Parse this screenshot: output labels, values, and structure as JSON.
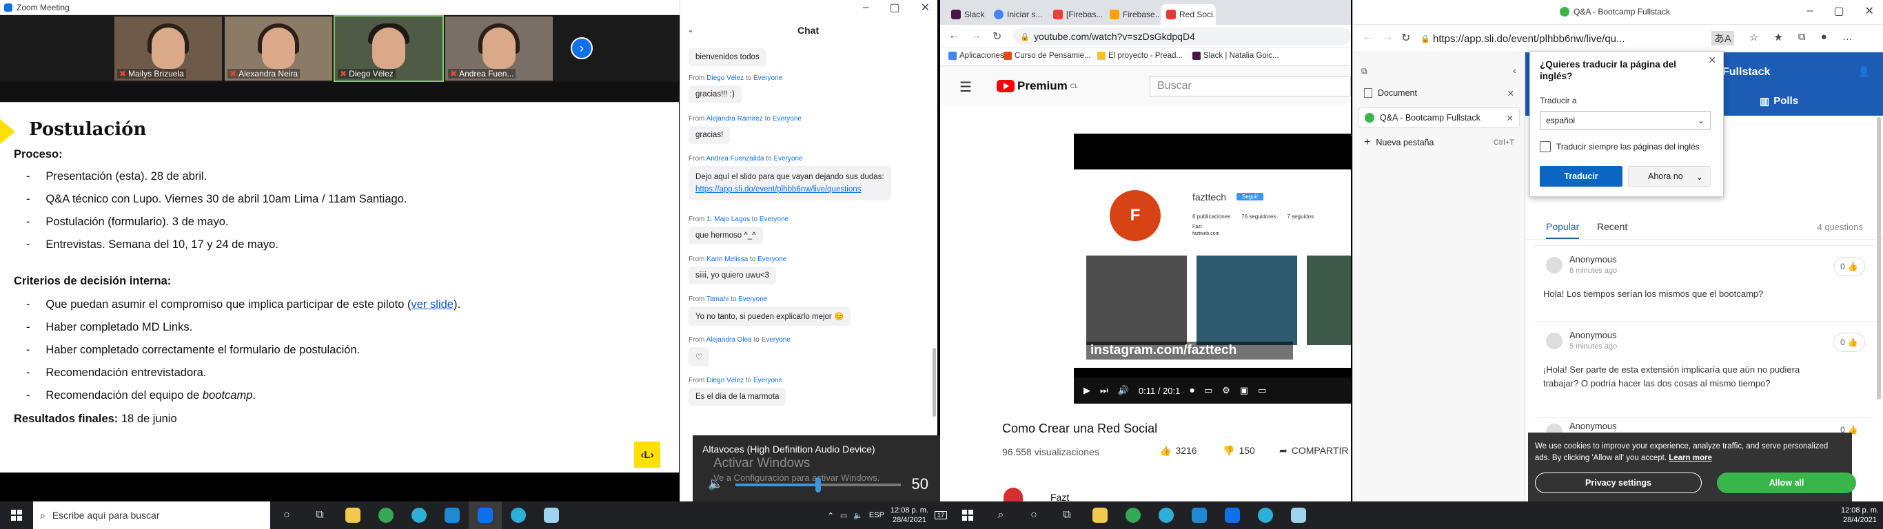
{
  "zoom": {
    "window_title": "Zoom Meeting",
    "participants": [
      "Mailys Brizuela",
      "Alexandra Neira",
      "Diego Vélez",
      "Andrea Fuen..."
    ],
    "slide": {
      "title": "Postulación",
      "proceso_label": "Proceso:",
      "proceso_items": [
        "Presentación (esta). 28 de abril.",
        "Q&A técnico con Lupo. Viernes 30 de abril 10am Lima / 11am Santiago.",
        "Postulación (formulario). 3 de mayo.",
        "Entrevistas. Semana del 10, 17 y 24 de mayo."
      ],
      "criterios_label": "Criterios de decisión interna:",
      "criterios_item_1_pre": "Que puedan asumir el compromiso que implica participar de este piloto (",
      "criterios_item_1_link": "ver slide",
      "criterios_item_1_post": ").",
      "criterios_items": [
        "Haber completado MD Links.",
        "Haber completado correctamente el formulario de postulación.",
        "Recomendación entrevistadora."
      ],
      "criterios_last_pre": "Recomendación del equipo de ",
      "criterios_last_em": "bootcamp",
      "criterios_last_post": ".",
      "resultados_label": "Resultados finales:",
      "resultados_value": " 18 de junio",
      "logo": "‹L›"
    },
    "chat": {
      "title": "Chat",
      "first_message": "bienvenidos todos",
      "messages": [
        {
          "from": "Diego Vélez",
          "to": "Everyone",
          "text": "gracias!!! :)"
        },
        {
          "from": "Alejandra Ramirez",
          "to": "Everyone",
          "text": "gracias!"
        },
        {
          "from": "Andrea Fuenzalida",
          "to": "Everyone",
          "text": "Dejo aquí el slido para que vayan dejando sus dudas:",
          "link": "https://app.sli.do/event/plhbb6nw/live/questions"
        },
        {
          "from": "1. Majo Lagos",
          "to": "Everyone",
          "text": "que hermoso ^_^"
        },
        {
          "from": "Karin Melissa",
          "to": "Everyone",
          "text": "siiii, yo quiero uwu<3"
        },
        {
          "from": "Tamahi",
          "to": "Everyone",
          "text": "Yo no tanto, si pueden explicarlo mejor 😊"
        },
        {
          "from": "Alejandra Olea",
          "to": "Everyone",
          "text": "♡"
        },
        {
          "from": "Diego Vélez",
          "to": "Everyone",
          "text": "Es el día de la marmota"
        }
      ],
      "from_word": "From",
      "to_word": "to"
    },
    "audio_popup": {
      "device": "Altavoces (High Definition Audio Device)",
      "volume": "50",
      "watermark_1": "Activar Windows",
      "watermark_2": "Ve a Configuración para activar Windows."
    }
  },
  "chrome": {
    "tabs": [
      "Slack | N...",
      "Iniciar s...",
      "[Firebas...",
      "Firebase...",
      "Red Soci..."
    ],
    "url": "youtube.com/watch?v=szDsGkdpqD4",
    "bookmarks": [
      "Aplicaciones",
      "Curso de Pensamie...",
      "El proyecto - Pread...",
      "Slack | Natalia Goic..."
    ],
    "youtube": {
      "logo": "Premium",
      "logo_sup": "CL",
      "search_placeholder": "Buscar",
      "video_title": "Como Crear una Red Social",
      "views": "96.558 visualizaciones",
      "likes": "3216",
      "dislikes": "150",
      "share": "COMPARTIR",
      "overlay_text": "instagram.com/fazttech",
      "profile_name": "fazttech",
      "follow_label": "Seguir",
      "stats": [
        "6 publicaciones",
        "76 seguidores",
        "7 seguidos"
      ],
      "bio_1": "Fazt",
      "bio_2": "faztweb.com",
      "time": "0:11 / 20:1",
      "channel": "Fazt"
    }
  },
  "edge": {
    "tab_title": "Q&A - Bootcamp Fullstack",
    "url": "https://app.sli.do/event/plhbb6nw/live/qu...",
    "vertical_tabs": [
      {
        "title": "Document"
      },
      {
        "title": "Q&A - Bootcamp Fullstack"
      }
    ],
    "new_tab": "Nueva pestaña",
    "new_tab_shortcut": "Ctrl+T",
    "translate": {
      "question": "¿Quieres traducir la página del inglés?",
      "to_label": "Traducir a",
      "language": "español",
      "always_label": "Traducir siempre las páginas del inglés",
      "translate_btn": "Traducir",
      "not_now_btn": "Ahora no"
    },
    "slido": {
      "header_title": "Fullstack",
      "polls_tab": "Polls",
      "popular_tab": "Popular",
      "recent_tab": "Recent",
      "count": "4 questions",
      "questions": [
        {
          "author": "Anonymous",
          "time": "8 minutes ago",
          "likes": "0",
          "text": "Hola! Los tiempos serían los mismos que el bootcamp?"
        },
        {
          "author": "Anonymous",
          "time": "5 minutes ago",
          "likes": "0",
          "text": "¡Hola! Ser parte de esta extensión implicaría que aún no pudiera",
          "text2": "trabajar? O podría hacer las dos cosas al mismo tiempo?"
        },
        {
          "author": "Anonymous",
          "time": "",
          "likes": "0",
          "text": ""
        }
      ]
    },
    "cookie": {
      "text": "We use cookies to improve your experience, analyze traffic, and serve personalized ads. By clicking 'Allow all' you accept.",
      "learn_more": "Learn more",
      "settings_btn": "Privacy settings",
      "allow_btn": "Allow all"
    }
  },
  "taskbar": {
    "search_placeholder": "Escribe aquí para buscar",
    "lang": "ESP",
    "time": "12:08 p. m.",
    "date": "28/4/2021",
    "notif_count": "17"
  },
  "colors": {
    "zoom_blue": "#0e71eb",
    "slide_yellow": "#ffe000",
    "slido_blue": "#1d5cb4",
    "edge_blue": "#0a66c2",
    "allow_green": "#3ab54a"
  }
}
